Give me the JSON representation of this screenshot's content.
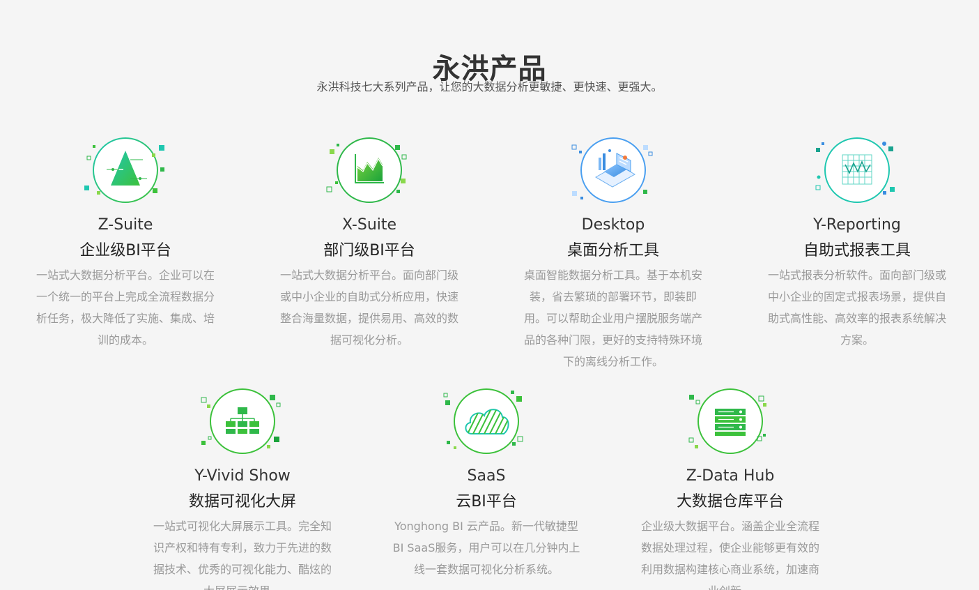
{
  "header": {
    "title": "永洪产品",
    "subtitle": "永洪科技七大系列产品，让您的大数据分析更敏捷、更快速、更强大。"
  },
  "colors": {
    "green": "#2fb84a",
    "teal": "#1fc7b0",
    "blue": "#3a8de0",
    "text_dark": "#333333",
    "text_light": "#999999"
  },
  "products": [
    {
      "icon": "pyramid-chart-icon",
      "name_en": "Z-Suite",
      "name_cn": "企业级BI平台",
      "desc": "一站式大数据分析平台。企业可以在一个统一的平台上完成全流程数据分析任务，极大降低了实施、集成、培训的成本。"
    },
    {
      "icon": "area-chart-icon",
      "name_en": "X-Suite",
      "name_cn": "部门级BI平台",
      "desc": "一站式大数据分析平台。面向部门级或中小企业的自助式分析应用，快速整合海量数据，提供易用、高效的数据可视化分析。"
    },
    {
      "icon": "desktop-dashboard-icon",
      "name_en": "Desktop",
      "name_cn": "桌面分析工具",
      "desc": "桌面智能数据分析工具。基于本机安装，省去繁琐的部署环节，即装即用。可以帮助企业用户摆脱服务端产品的各种门限，更好的支持特殊环境下的离线分析工作。"
    },
    {
      "icon": "report-grid-icon",
      "name_en": "Y-Reporting",
      "name_cn": "自助式报表工具",
      "desc": "一站式报表分析软件。面向部门级或中小企业的固定式报表场景，提供自助式高性能、高效率的报表系统解决方案。"
    },
    {
      "icon": "org-chart-icon",
      "name_en": "Y-Vivid Show",
      "name_cn": "数据可视化大屏",
      "desc": "一站式可视化大屏展示工具。完全知识产权和特有专利，致力于先进的数据技术、优秀的可视化能力、酷炫的大屏展示效果。"
    },
    {
      "icon": "cloud-icon",
      "name_en": "SaaS",
      "name_cn": "云BI平台",
      "desc": "Yonghong BI 云产品。新一代敏捷型BI SaaS服务，用户可以在几分钟内上线一套数据可视化分析系统。"
    },
    {
      "icon": "database-icon",
      "name_en": "Z-Data Hub",
      "name_cn": "大数据仓库平台",
      "desc": "企业级大数据平台。涵盖企业全流程数据处理过程，使企业能够更有效的利用数据构建核心商业系统，加速商业创新。"
    }
  ]
}
